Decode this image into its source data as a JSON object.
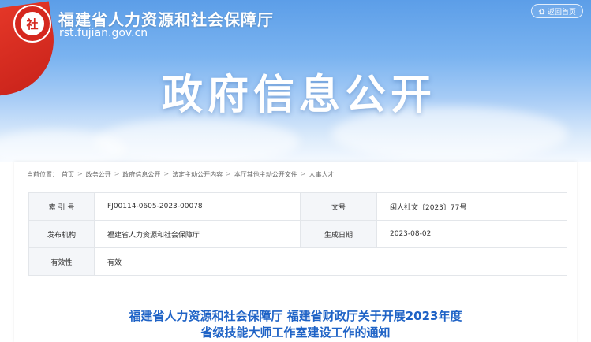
{
  "header": {
    "logo_char": "社",
    "site_name": "福建省人力资源和社会保障厅",
    "site_url": "rst.fujian.gov.cn",
    "home_label": "返回首页",
    "banner_title": "政府信息公开"
  },
  "breadcrumb": {
    "prefix": "当前位置：",
    "items": [
      "首页",
      "政务公开",
      "政府信息公开",
      "法定主动公开内容",
      "本厅其他主动公开文件",
      "人事人才"
    ]
  },
  "info": {
    "index_label": "索 引 号",
    "index_value": "FJ00114-0605-2023-00078",
    "doc_no_label": "文号",
    "doc_no_value": "闽人社文〔2023〕77号",
    "issuer_label": "发布机构",
    "issuer_value": "福建省人力资源和社会保障厅",
    "date_label": "生成日期",
    "date_value": "2023-08-02",
    "validity_label": "有效性",
    "validity_value": "有效"
  },
  "document": {
    "title_line1": "福建省人力资源和社会保障厅 福建省财政厅关于开展2023年度",
    "title_line2": "省级技能大师工作室建设工作的通知"
  }
}
